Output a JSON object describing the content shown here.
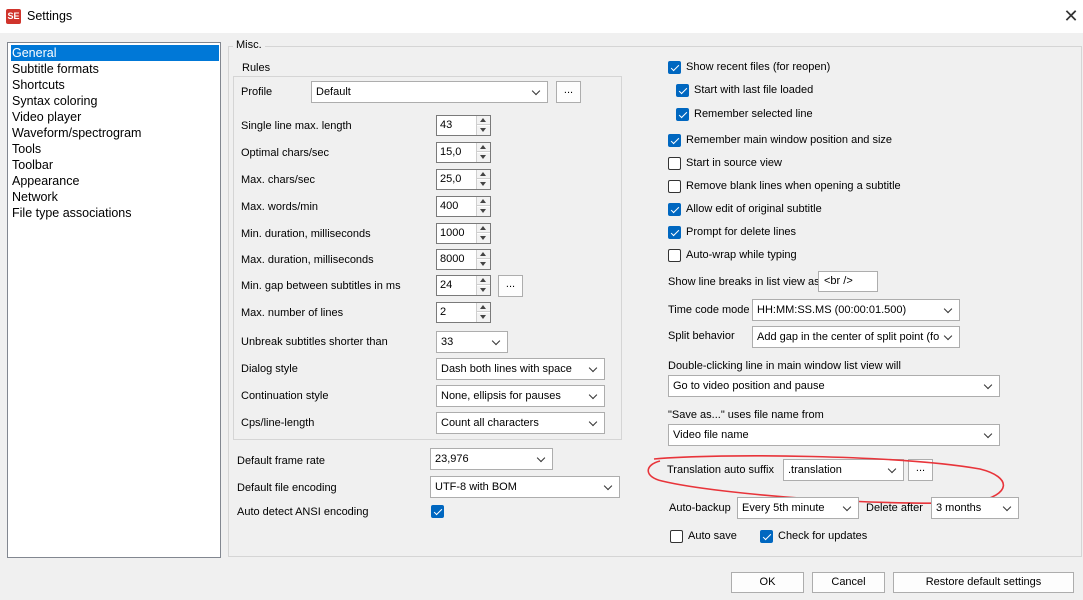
{
  "window": {
    "title": "Settings",
    "app_icon": "SE",
    "close_glyph": "✕"
  },
  "nav": {
    "items": [
      "General",
      "Subtitle formats",
      "Shortcuts",
      "Syntax coloring",
      "Video player",
      "Waveform/spectrogram",
      "Tools",
      "Toolbar",
      "Appearance",
      "Network",
      "File type associations"
    ],
    "selected": "General"
  },
  "misc": {
    "title": "Misc.",
    "rules": {
      "title": "Rules",
      "profile_label": "Profile",
      "profile_value": "Default",
      "ellipsis": "...",
      "single_line_max_length": {
        "label": "Single line max. length",
        "value": "43"
      },
      "optimal_chars_sec": {
        "label": "Optimal chars/sec",
        "value": "15,0"
      },
      "max_chars_sec": {
        "label": "Max. chars/sec",
        "value": "25,0"
      },
      "max_words_min": {
        "label": "Max. words/min",
        "value": "400"
      },
      "min_duration": {
        "label": "Min. duration, milliseconds",
        "value": "1000"
      },
      "max_duration": {
        "label": "Max. duration, milliseconds",
        "value": "8000"
      },
      "min_gap": {
        "label": "Min. gap between subtitles in ms",
        "value": "24"
      },
      "max_lines": {
        "label": "Max. number of lines",
        "value": "2"
      },
      "unbreak_shorter": {
        "label": "Unbreak subtitles shorter than",
        "value": "33"
      },
      "dialog_style": {
        "label": "Dialog style",
        "value": "Dash both lines with space"
      },
      "continuation_style": {
        "label": "Continuation style",
        "value": "None, ellipsis for pauses"
      },
      "cps_line_length": {
        "label": "Cps/line-length",
        "value": "Count all characters"
      }
    },
    "default_frame_rate": {
      "label": "Default frame rate",
      "value": "23,976"
    },
    "default_file_encoding": {
      "label": "Default file encoding",
      "value": "UTF-8 with BOM"
    },
    "auto_detect_ansi": {
      "label": "Auto detect ANSI encoding",
      "checked": true
    },
    "right": {
      "show_recent_files": {
        "label": "Show recent files (for reopen)",
        "checked": true
      },
      "start_with_last_file": {
        "label": "Start with last file loaded",
        "checked": true
      },
      "remember_selected_line": {
        "label": "Remember selected line",
        "checked": true
      },
      "remember_main_window": {
        "label": "Remember main window position and size",
        "checked": true
      },
      "start_in_source_view": {
        "label": "Start in source view",
        "checked": false
      },
      "remove_blank_lines": {
        "label": "Remove blank lines when opening a subtitle",
        "checked": false
      },
      "allow_edit_original": {
        "label": "Allow edit of original subtitle",
        "checked": true
      },
      "prompt_delete_lines": {
        "label": "Prompt for delete lines",
        "checked": true
      },
      "auto_wrap": {
        "label": "Auto-wrap while typing",
        "checked": false
      },
      "line_breaks": {
        "label": "Show line breaks in list view as",
        "value": "<br />"
      },
      "time_code_mode": {
        "label": "Time code mode",
        "value": "HH:MM:SS.MS (00:00:01.500)"
      },
      "split_behavior": {
        "label": "Split behavior",
        "value": "Add gap in the center of split point (fo"
      },
      "double_click": {
        "label": "Double-clicking line in main window list view will",
        "value": "Go to video position and pause"
      },
      "save_as": {
        "label": "\"Save as...\" uses file name from",
        "value": "Video file name"
      },
      "translation_suffix": {
        "label": "Translation auto suffix",
        "value": ".translation"
      },
      "auto_backup": {
        "label": "Auto-backup",
        "value": "Every 5th minute"
      },
      "delete_after": {
        "label": "Delete after",
        "value": "3 months"
      },
      "auto_save": {
        "label": "Auto save",
        "checked": false
      },
      "check_updates": {
        "label": "Check for updates",
        "checked": true
      }
    }
  },
  "buttons": {
    "ok": "OK",
    "cancel": "Cancel",
    "restore": "Restore default settings"
  },
  "colors": {
    "accent": "#0067c0",
    "selection": "#0078d7",
    "annotation": "#e8343a"
  }
}
